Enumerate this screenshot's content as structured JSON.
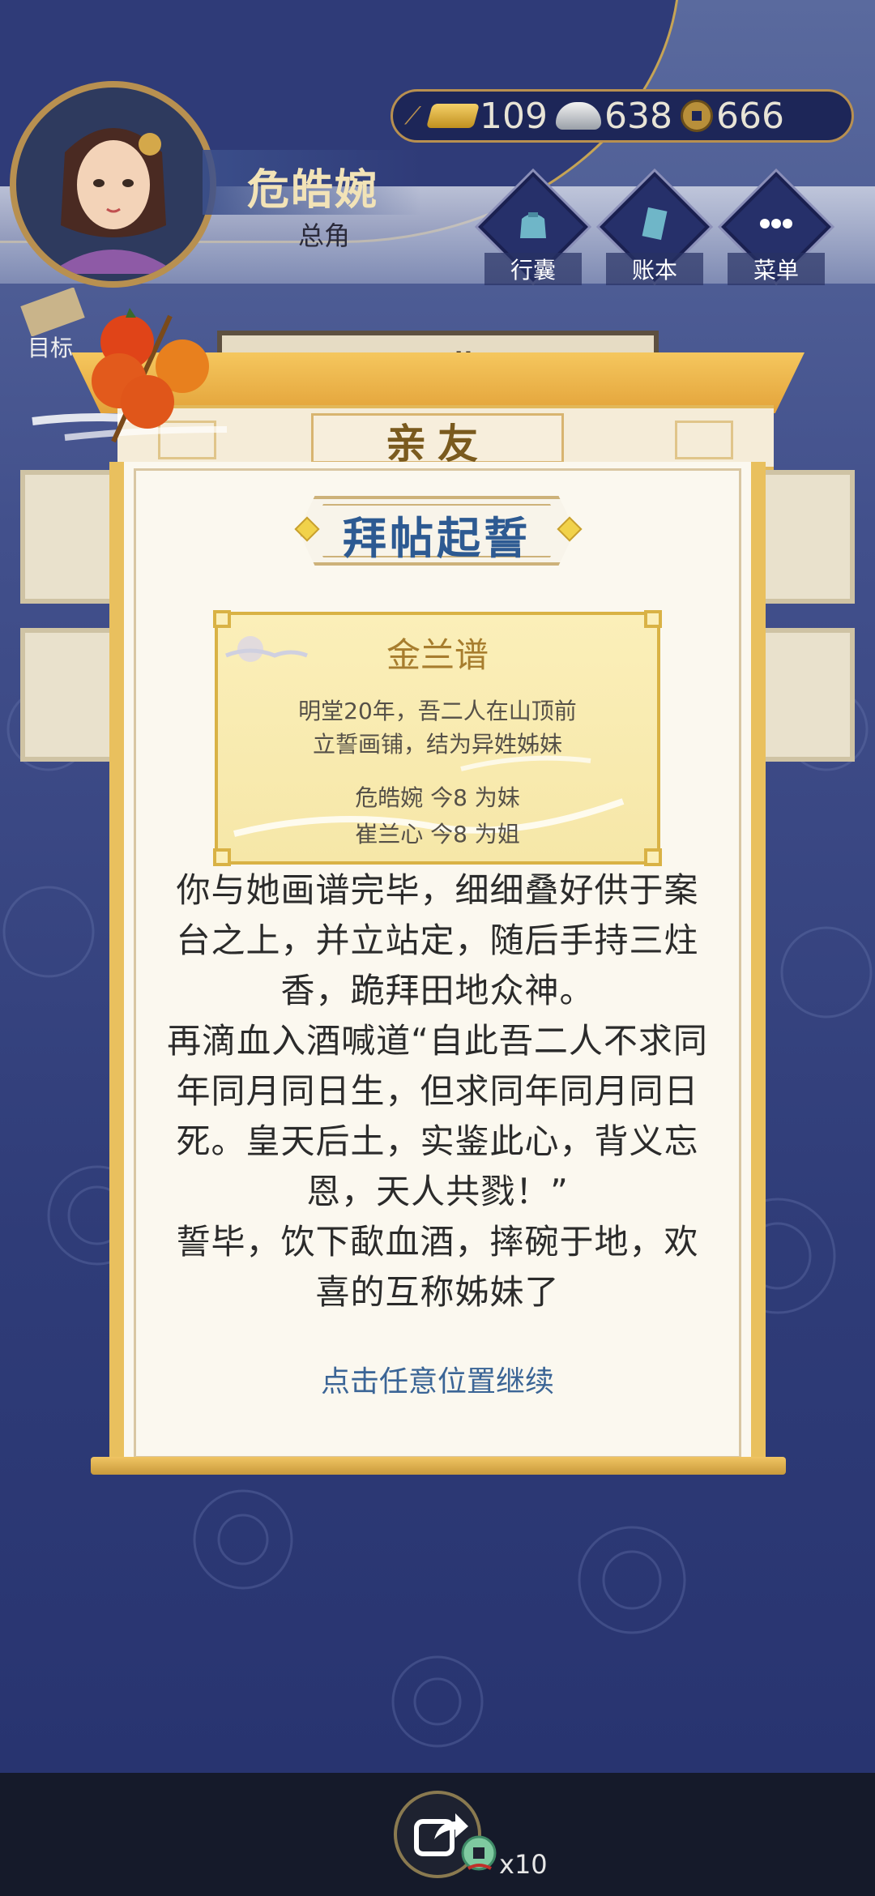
{
  "player": {
    "name": "危皓婉",
    "role": "总角"
  },
  "currency": {
    "gold": "109",
    "silver": "638",
    "coins": "666"
  },
  "menu": {
    "bag": "行囊",
    "ledger": "账本",
    "menu": "菜单"
  },
  "goal_label": "目标",
  "career_label": "职业",
  "panel": {
    "tab_title": "亲友",
    "heading": "拜帖起誓",
    "certificate": {
      "title": "金兰谱",
      "line1": "明堂20年，吾二人在山顶前",
      "line2": "立誓画铺，结为异姓姊妹",
      "member1": "危皓婉 今8 为妹",
      "member2": "崔兰心 今8 为姐"
    },
    "story": [
      "你与她画谱完毕，细细叠好供于案台之上，并立站定，随后手持三炷香，跪拜田地众神。",
      "再滴血入酒喊道“自此吾二人不求同年同月同日生，但求同年同月同日死。皇天后土，实鉴此心，背义忘恩，天人共戮！”",
      "誓毕，饮下歃血酒，摔碗于地，欢喜的互称姊妹了"
    ],
    "continue_hint": "点击任意位置继续"
  },
  "share": {
    "count": "x10"
  },
  "colors": {
    "accent_gold": "#e9c05e",
    "heading_blue": "#2d5a92",
    "background_navy": "#2f3c78"
  }
}
